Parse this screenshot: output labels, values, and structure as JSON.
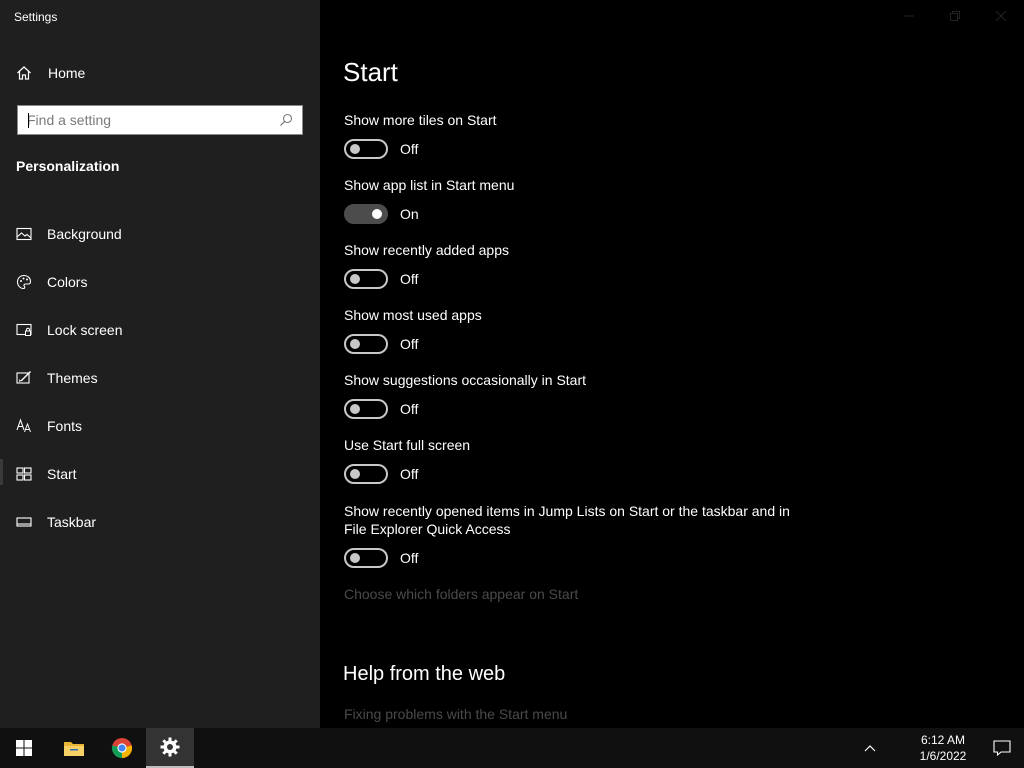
{
  "window": {
    "title": "Settings"
  },
  "sidebar": {
    "home_label": "Home",
    "search_placeholder": "Find a setting",
    "section_title": "Personalization",
    "items": [
      {
        "label": "Background",
        "icon": "picture-icon"
      },
      {
        "label": "Colors",
        "icon": "palette-icon"
      },
      {
        "label": "Lock screen",
        "icon": "lock-screen-icon"
      },
      {
        "label": "Themes",
        "icon": "themes-icon"
      },
      {
        "label": "Fonts",
        "icon": "fonts-icon"
      },
      {
        "label": "Start",
        "icon": "start-icon",
        "active": true
      },
      {
        "label": "Taskbar",
        "icon": "taskbar-icon"
      }
    ]
  },
  "main": {
    "title": "Start",
    "settings": [
      {
        "label": "Show more tiles on Start",
        "state": "Off"
      },
      {
        "label": "Show app list in Start menu",
        "state": "On"
      },
      {
        "label": "Show recently added apps",
        "state": "Off"
      },
      {
        "label": "Show most used apps",
        "state": "Off"
      },
      {
        "label": "Show suggestions occasionally in Start",
        "state": "Off"
      },
      {
        "label": "Use Start full screen",
        "state": "Off"
      },
      {
        "label": "Show recently opened items in Jump Lists on Start or the taskbar and in File Explorer Quick Access",
        "state": "Off"
      }
    ],
    "folders_link": "Choose which folders appear on Start",
    "help_title": "Help from the web",
    "help_link": "Fixing problems with the Start menu"
  },
  "taskbar": {
    "time": "6:12 AM",
    "date": "1/6/2022"
  },
  "colors": {
    "sidebar_bg": "#1f1f1f",
    "content_bg": "#000000",
    "toggle_on": "#4c4c4c",
    "dim_text": "#4a4a4a"
  }
}
